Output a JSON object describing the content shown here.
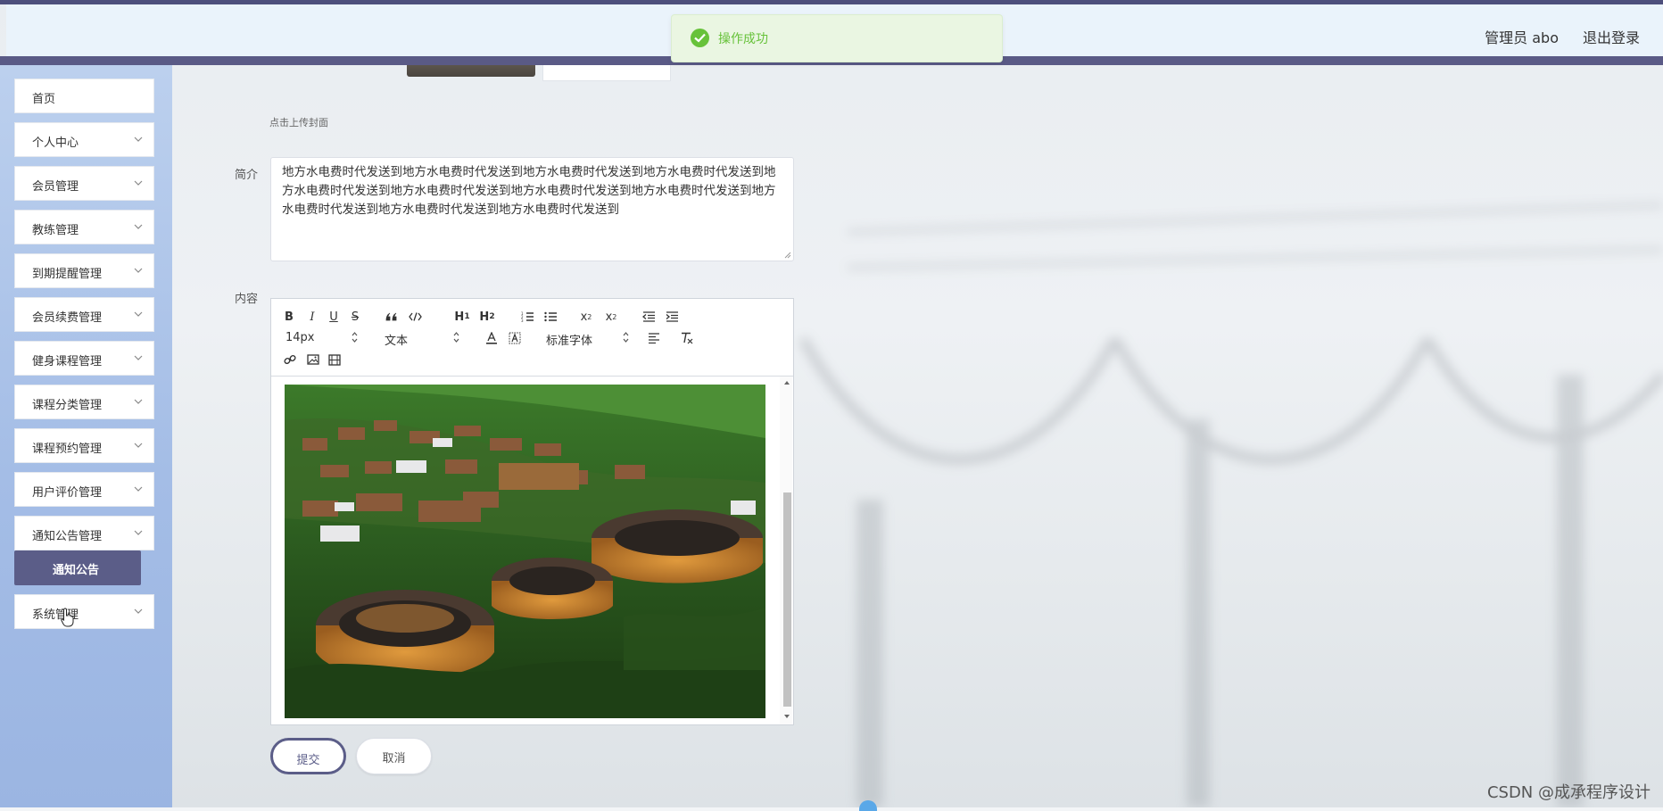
{
  "header": {
    "user_label": "管理员 abo",
    "logout_label": "退出登录"
  },
  "toast": {
    "message": "操作成功",
    "color": "#67c23a"
  },
  "sidebar": {
    "items": [
      {
        "label": "首页",
        "has_chevron": false
      },
      {
        "label": "个人中心",
        "has_chevron": true
      },
      {
        "label": "会员管理",
        "has_chevron": true
      },
      {
        "label": "教练管理",
        "has_chevron": true
      },
      {
        "label": "到期提醒管理",
        "has_chevron": true
      },
      {
        "label": "会员续费管理",
        "has_chevron": true
      },
      {
        "label": "健身课程管理",
        "has_chevron": true
      },
      {
        "label": "课程分类管理",
        "has_chevron": true
      },
      {
        "label": "课程预约管理",
        "has_chevron": true
      },
      {
        "label": "用户评价管理",
        "has_chevron": true
      },
      {
        "label": "通知公告管理",
        "has_chevron": true
      },
      {
        "label": "系统管理",
        "has_chevron": true
      }
    ],
    "active_sub_item": "通知公告",
    "accent_color": "#5b5d88"
  },
  "form": {
    "upload_hint": "点击上传封面",
    "summary_label": "简介",
    "summary_value": "地方水电费时代发送到地方水电费时代发送到地方水电费时代发送到地方水电费时代发送到地方水电费时代发送到地方水电费时代发送到地方水电费时代发送到地方水电费时代发送到地方水电费时代发送到地方水电费时代发送到地方水电费时代发送到",
    "content_label": "内容",
    "submit_label": "提交",
    "cancel_label": "取消"
  },
  "editor": {
    "size_picker": "14px",
    "header_picker": "文本",
    "font_picker": "标准字体",
    "toolbar_icons": [
      "bold-icon",
      "italic-icon",
      "underline-icon",
      "strike-icon",
      "blockquote-icon",
      "code-block-icon",
      "h1-icon",
      "h2-icon",
      "ordered-list-icon",
      "bullet-list-icon",
      "subscript-icon",
      "superscript-icon",
      "outdent-icon",
      "indent-icon",
      "text-color-icon",
      "background-color-icon",
      "align-icon",
      "clean-format-icon",
      "link-icon",
      "image-icon",
      "video-icon"
    ]
  },
  "watermark": "CSDN @成承程序设计"
}
